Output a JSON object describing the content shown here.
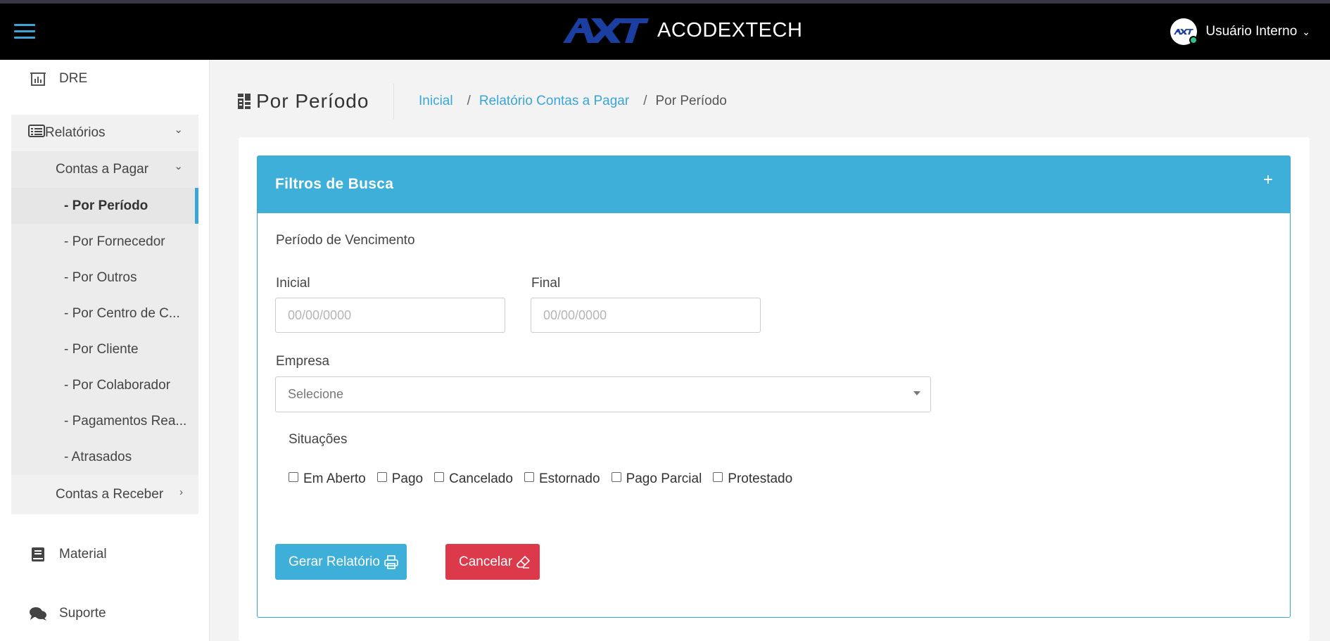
{
  "header": {
    "brand_name": "ACODEXTECH",
    "user_name": "Usuário Interno",
    "accent_color": "#3aa6d8"
  },
  "sidebar": {
    "dre_label": "DRE",
    "reports_label": "Relatórios",
    "payables_label": "Contas a Pagar",
    "payables_items": [
      "- Por Período",
      "- Por Fornecedor",
      "- Por Outros",
      "- Por Centro de C...",
      "- Por Cliente",
      "- Por Colaborador",
      "- Pagamentos Rea...",
      "- Atrasados"
    ],
    "receivables_label": "Contas a Receber",
    "material_label": "Material",
    "support_label": "Suporte"
  },
  "page": {
    "title": "Por Período",
    "breadcrumb": [
      "Inicial",
      "Relatório Contas a Pagar",
      "Por Período"
    ]
  },
  "filters": {
    "title": "Filtros de Busca",
    "toggle": "+",
    "period_label": "Período de Vencimento",
    "start_label": "Inicial",
    "start_placeholder": "00/00/0000",
    "end_label": "Final",
    "end_placeholder": "00/00/0000",
    "company_label": "Empresa",
    "company_value": "Selecione",
    "status_label": "Situações",
    "status_options": [
      "Em Aberto",
      "Pago",
      "Cancelado",
      "Estornado",
      "Pago Parcial",
      "Protestado"
    ],
    "generate_label": "Gerar Relatório",
    "cancel_label": "Cancelar",
    "primary_color": "#3eafd9",
    "danger_color": "#dc3a4b"
  }
}
